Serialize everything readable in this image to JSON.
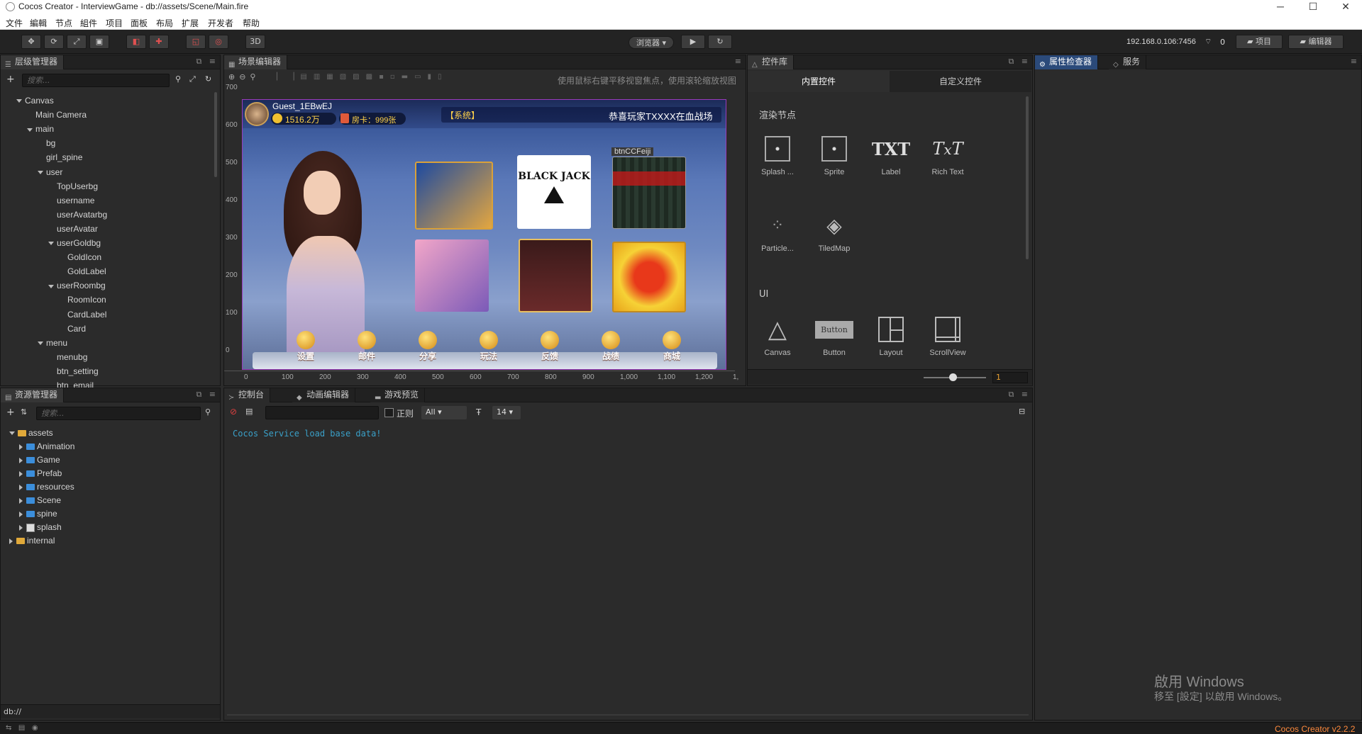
{
  "window": {
    "title": "Cocos Creator - InterviewGame - db://assets/Scene/Main.fire",
    "controls": {
      "minimize": "─",
      "maximize": "☐",
      "close": "✕"
    }
  },
  "menu": [
    "文件",
    "編輯",
    "节点",
    "組件",
    "项目",
    "面板",
    "布局",
    "扩展",
    "开发者",
    "帮助"
  ],
  "toolbar": {
    "mode3d": "3D",
    "preview_target": "浏览器 ▾",
    "ip": "192.168.0.106:7456",
    "device_count": "0",
    "project_btn": "项目",
    "editor_btn": "编辑器"
  },
  "hierarchy": {
    "title": "层级管理器",
    "search_placeholder": "搜索...",
    "nodes": [
      {
        "label": "Canvas",
        "depth": 0,
        "expanded": true
      },
      {
        "label": "Main Camera",
        "depth": 1
      },
      {
        "label": "main",
        "depth": 1,
        "expanded": true
      },
      {
        "label": "bg",
        "depth": 2
      },
      {
        "label": "girl_spine",
        "depth": 2
      },
      {
        "label": "user",
        "depth": 2,
        "expanded": true
      },
      {
        "label": "TopUserbg",
        "depth": 3
      },
      {
        "label": "username",
        "depth": 3
      },
      {
        "label": "userAvatarbg",
        "depth": 3
      },
      {
        "label": "userAvatar",
        "depth": 3
      },
      {
        "label": "userGoldbg",
        "depth": 3,
        "expanded": true
      },
      {
        "label": "GoldIcon",
        "depth": 4
      },
      {
        "label": "GoldLabel",
        "depth": 4
      },
      {
        "label": "userRoombg",
        "depth": 3,
        "expanded": true
      },
      {
        "label": "RoomIcon",
        "depth": 4
      },
      {
        "label": "CardLabel",
        "depth": 4
      },
      {
        "label": "Card",
        "depth": 4
      },
      {
        "label": "menu",
        "depth": 2,
        "expanded": true
      },
      {
        "label": "menubg",
        "depth": 3
      },
      {
        "label": "btn_setting",
        "depth": 3
      },
      {
        "label": "btn_email",
        "depth": 3
      }
    ]
  },
  "scene_editor": {
    "title": "场景编辑器",
    "hint": "使用鼠标右键平移视窗焦点，使用滚轮缩放视图",
    "y_ticks": [
      "700",
      "600",
      "500",
      "400",
      "300",
      "200",
      "100",
      "0"
    ],
    "x_ticks": [
      "0",
      "100",
      "200",
      "300",
      "400",
      "500",
      "600",
      "700",
      "800",
      "900",
      "1,000",
      "1,100",
      "1,200",
      "1,"
    ],
    "game": {
      "username": "Guest_1EBwEJ",
      "gold": "1516.2万",
      "room_card": "房卡：999张",
      "system_tag": "【系统】",
      "marquee": "恭喜玩家TXXXX在血战场",
      "selected_node": "btnCCFeiji",
      "blackjack": "BLACK JACK",
      "menu_buttons": [
        "设置",
        "邮件",
        "分享",
        "玩法",
        "反馈",
        "战绩",
        "商城"
      ]
    }
  },
  "assets": {
    "title": "资源管理器",
    "search_placeholder": "搜索...",
    "items": [
      {
        "label": "assets",
        "depth": 0,
        "type": "root"
      },
      {
        "label": "Animation",
        "depth": 1,
        "type": "folder"
      },
      {
        "label": "Game",
        "depth": 1,
        "type": "folder"
      },
      {
        "label": "Prefab",
        "depth": 1,
        "type": "folder"
      },
      {
        "label": "resources",
        "depth": 1,
        "type": "folder"
      },
      {
        "label": "Scene",
        "depth": 1,
        "type": "folder"
      },
      {
        "label": "spine",
        "depth": 1,
        "type": "folder"
      },
      {
        "label": "splash",
        "depth": 1,
        "type": "image"
      },
      {
        "label": "internal",
        "depth": 0,
        "type": "root"
      }
    ],
    "footer": "db://"
  },
  "console": {
    "tabs": [
      "控制台",
      "动画编辑器",
      "游戏预览"
    ],
    "regex_label": "正则",
    "filter": "All ▾",
    "font_size": "14 ▾",
    "lines": [
      "Cocos Service load base data!"
    ]
  },
  "widgets": {
    "title": "控件库",
    "tabs": [
      "内置控件",
      "自定义控件"
    ],
    "section_render": "渲染节点",
    "render_items": [
      {
        "label": "Splash ...",
        "icon": "splash-icon"
      },
      {
        "label": "Sprite",
        "icon": "sprite-icon"
      },
      {
        "label": "Label",
        "icon": "label-icon"
      },
      {
        "label": "Rich Text",
        "icon": "richtext-icon"
      },
      {
        "label": "Particle...",
        "icon": "particle-icon"
      },
      {
        "label": "TiledMap",
        "icon": "tiledmap-icon"
      }
    ],
    "section_ui": "UI",
    "ui_items": [
      {
        "label": "Canvas",
        "icon": "canvas-icon"
      },
      {
        "label": "Button",
        "icon": "button-icon"
      },
      {
        "label": "Layout",
        "icon": "layout-icon"
      },
      {
        "label": "ScrollView",
        "icon": "scrollview-icon"
      }
    ],
    "zoom_value": "1"
  },
  "inspector": {
    "tabs": [
      "属性检查器",
      "服务"
    ]
  },
  "watermark": {
    "line1": "啟用 Windows",
    "line2": "移至 [設定] 以啟用 Windows。"
  },
  "status": {
    "version": "Cocos Creator v2.2.2"
  },
  "colors": {
    "accent": "#2b4a7a",
    "version": "#ff8a3d",
    "console": "#3aa0c8"
  }
}
